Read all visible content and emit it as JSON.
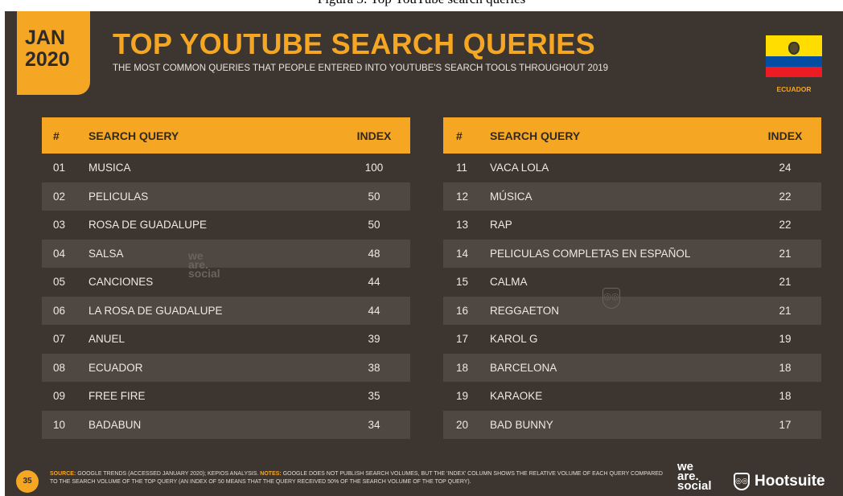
{
  "caption": "Figura 3: Top YouTube search queries",
  "date": {
    "month": "JAN",
    "year": "2020"
  },
  "title": "TOP YOUTUBE SEARCH QUERIES",
  "subtitle": "THE MOST COMMON QUERIES THAT PEOPLE ENTERED INTO YOUTUBE'S SEARCH TOOLS THROUGHOUT 2019",
  "country": "ECUADOR",
  "headers": {
    "num": "#",
    "query": "SEARCH QUERY",
    "index": "INDEX"
  },
  "left_rows": [
    {
      "num": "01",
      "query": "MUSICA",
      "index": "100"
    },
    {
      "num": "02",
      "query": "PELICULAS",
      "index": "50"
    },
    {
      "num": "03",
      "query": "ROSA DE GUADALUPE",
      "index": "50"
    },
    {
      "num": "04",
      "query": "SALSA",
      "index": "48"
    },
    {
      "num": "05",
      "query": "CANCIONES",
      "index": "44"
    },
    {
      "num": "06",
      "query": "LA ROSA DE GUADALUPE",
      "index": "44"
    },
    {
      "num": "07",
      "query": "ANUEL",
      "index": "39"
    },
    {
      "num": "08",
      "query": "ECUADOR",
      "index": "38"
    },
    {
      "num": "09",
      "query": "FREE FIRE",
      "index": "35"
    },
    {
      "num": "10",
      "query": "BADABUN",
      "index": "34"
    }
  ],
  "right_rows": [
    {
      "num": "11",
      "query": "VACA LOLA",
      "index": "24"
    },
    {
      "num": "12",
      "query": "MÚSICA",
      "index": "22"
    },
    {
      "num": "13",
      "query": "RAP",
      "index": "22"
    },
    {
      "num": "14",
      "query": "PELICULAS COMPLETAS EN ESPAÑOL",
      "index": "21"
    },
    {
      "num": "15",
      "query": "CALMA",
      "index": "21"
    },
    {
      "num": "16",
      "query": "REGGAETON",
      "index": "21"
    },
    {
      "num": "17",
      "query": "KAROL G",
      "index": "19"
    },
    {
      "num": "18",
      "query": "BARCELONA",
      "index": "18"
    },
    {
      "num": "19",
      "query": "KARAOKE",
      "index": "18"
    },
    {
      "num": "20",
      "query": "BAD BUNNY",
      "index": "17"
    }
  ],
  "watermark": {
    "line1": "we",
    "line2": "are.",
    "line3": "social"
  },
  "page_number": "35",
  "footer": {
    "source_tag": "SOURCE:",
    "source_text": " GOOGLE TRENDS (ACCESSED JANUARY 2020); KEPIOS ANALYSIS. ",
    "notes_tag": "NOTES:",
    "notes_text": " GOOGLE DOES NOT PUBLISH SEARCH VOLUMES, BUT THE 'INDEX' COLUMN SHOWS THE RELATIVE VOLUME OF EACH QUERY COMPARED TO THE SEARCH VOLUME OF THE TOP QUERY (AN INDEX OF 50 MEANS THAT THE QUERY RECEIVED 50% OF THE SEARCH VOLUME OF THE TOP QUERY)."
  },
  "logos": {
    "ws_line1": "we",
    "ws_line2": "are.",
    "ws_line3": "social",
    "hootsuite": "Hootsuite"
  },
  "colors": {
    "accent": "#f5a623",
    "background": "#3d3630",
    "row_shade": "#4f4741"
  }
}
